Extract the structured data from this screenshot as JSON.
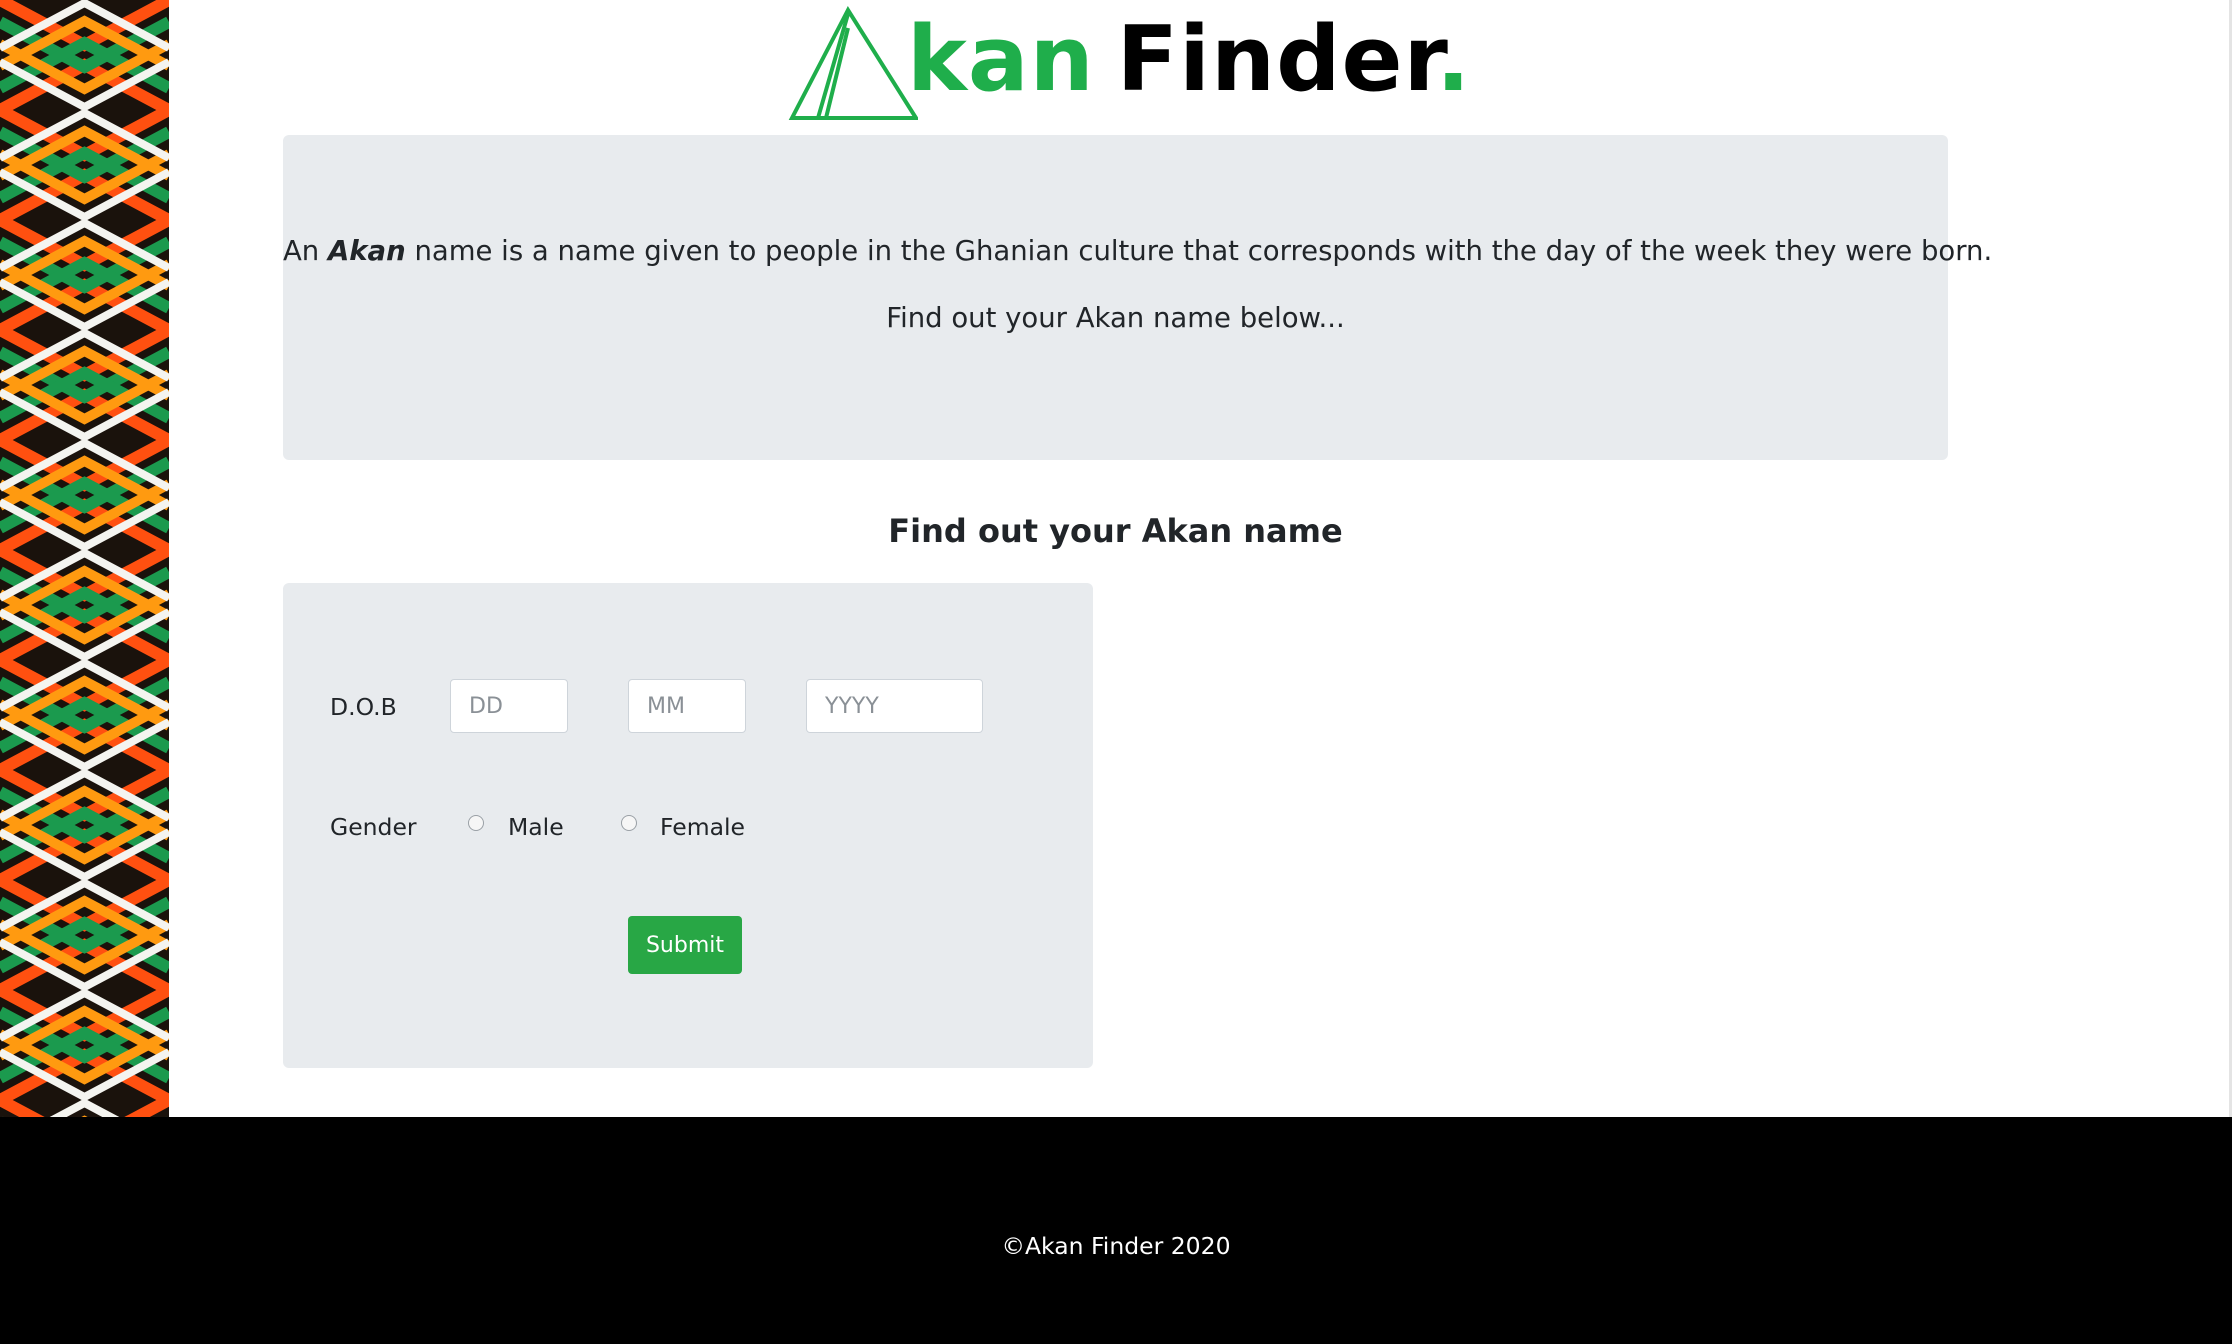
{
  "brand": {
    "logo_text": "Akan Finder.",
    "logo_wordmark": "kan",
    "logo_wordmark_2": "Finder",
    "logo_dot": ".",
    "accent_color": "#1fae4b"
  },
  "intro": {
    "line1_prefix": "An ",
    "line1_emphasis": "Akan",
    "line1_suffix": " name is a name given to people in the Ghanian culture that corresponds with the day of the week they were born.",
    "line2": "Find out your Akan name below..."
  },
  "form": {
    "heading": "Find out your Akan name",
    "dob_label": "D.O.B",
    "day_placeholder": "DD",
    "month_placeholder": "MM",
    "year_placeholder": "YYYY",
    "gender_label": "Gender",
    "gender_options": [
      "Male",
      "Female"
    ],
    "submit_label": "Submit",
    "submit_color": "#28a745"
  },
  "footer": {
    "text": "©Akan Finder 2020"
  },
  "icons": {
    "logo_mark": "triangle-icon",
    "side_pattern": "kente-pattern"
  }
}
